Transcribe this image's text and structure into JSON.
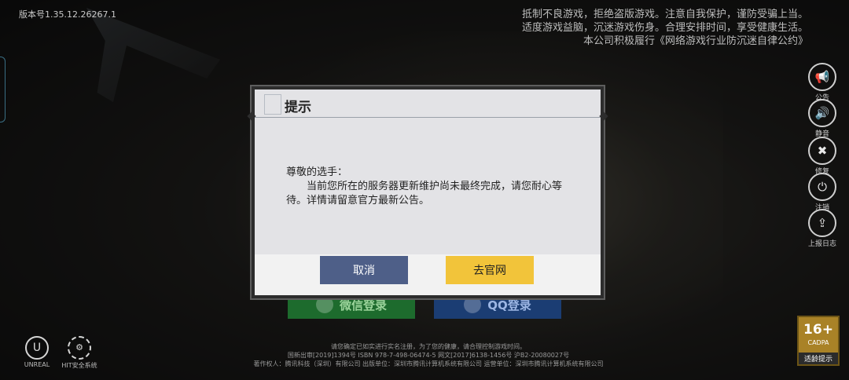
{
  "version": "版本号1.35.12.26267.1",
  "notice_lines": [
    "抵制不良游戏，拒绝盗版游戏。注意自我保护，谨防受骗上当。",
    "适度游戏益脑，沉迷游戏伤身。合理安排时间，享受健康生活。",
    "本公司积极履行《网络游戏行业防沉迷自律公约》"
  ],
  "side_buttons": {
    "announce": "公告",
    "mute": "静音",
    "repair": "修复",
    "logout": "注销",
    "report_log": "上报日志"
  },
  "login": {
    "wechat": "微信登录",
    "qq": "QQ登录"
  },
  "logos": {
    "unreal": "UNREAL",
    "hit": "HIT安全系统"
  },
  "legal_lines": [
    "请您确定已如实进行实名注册，为了您的健康，请合理控制游戏时间。",
    "国新出审[2019]1394号  ISBN 978-7-498-06474-5  网文[2017]6138-1456号  沪B2-20080027号",
    "著作权人：腾讯科技（深圳）有限公司    出版单位：深圳市腾讯计算机系统有限公司    运营单位：深圳市腾讯计算机系统有限公司"
  ],
  "age_rating": {
    "age": "16+",
    "subtitle": "CADPA",
    "caption": "适龄提示"
  },
  "dialog": {
    "title": "提示",
    "greeting": "尊敬的选手：",
    "message": "当前您所在的服务器更新维护尚未最终完成，请您耐心等待。详情请留意官方最新公告。",
    "cancel_label": "取消",
    "official_label": "去官网"
  }
}
